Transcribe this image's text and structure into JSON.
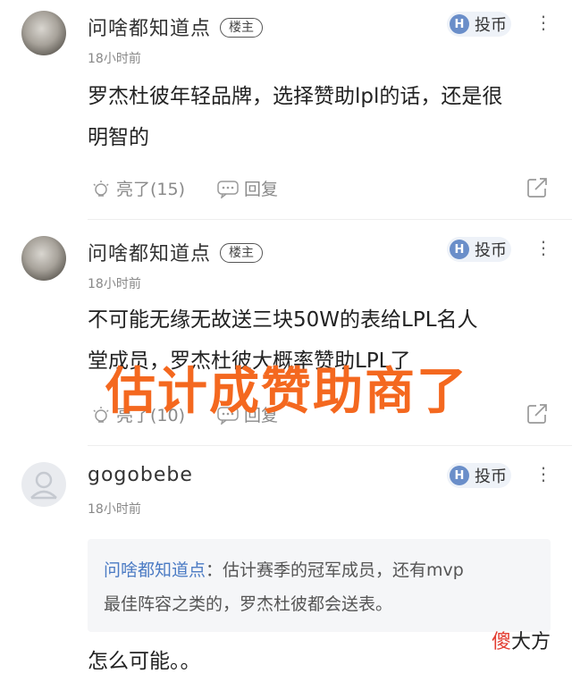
{
  "comments": [
    {
      "username": "问啥都知道点",
      "badge": "楼主",
      "coin_label": "投币",
      "coin_icon": "H",
      "time": "18小时前",
      "content_lines": [
        "罗杰杜彼年轻品牌，选择赞助lpl的话，还是很",
        "明智的"
      ],
      "like_label": "亮了(15)",
      "reply_label": "回复"
    },
    {
      "username": "问啥都知道点",
      "badge": "楼主",
      "coin_label": "投币",
      "coin_icon": "H",
      "time": "18小时前",
      "content_lines": [
        "不可能无缘无故送三块50W的表给LPL名人",
        "堂成员，罗杰杜彼大概率赞助LPL了"
      ],
      "like_label": "亮了(10)",
      "reply_label": "回复"
    },
    {
      "username": "gogobebe",
      "coin_label": "投币",
      "coin_icon": "H",
      "time": "18小时前",
      "quote": {
        "name": "问啥都知道点",
        "separator": "：",
        "text_line1": "估计赛季的冠军成员，还有mvp",
        "text_line2": "最佳阵容之类的，罗杰杜彼都会送表。"
      },
      "content_lines": [
        "怎么可能。。"
      ]
    }
  ],
  "overlay_text": "估计成赞助商了",
  "watermark": {
    "part1": "傻",
    "part2": "大方"
  },
  "colors": {
    "overlay": "#f4681f",
    "quote_name": "#4b7bc4",
    "coin_icon_bg": "#6a8ec9"
  }
}
